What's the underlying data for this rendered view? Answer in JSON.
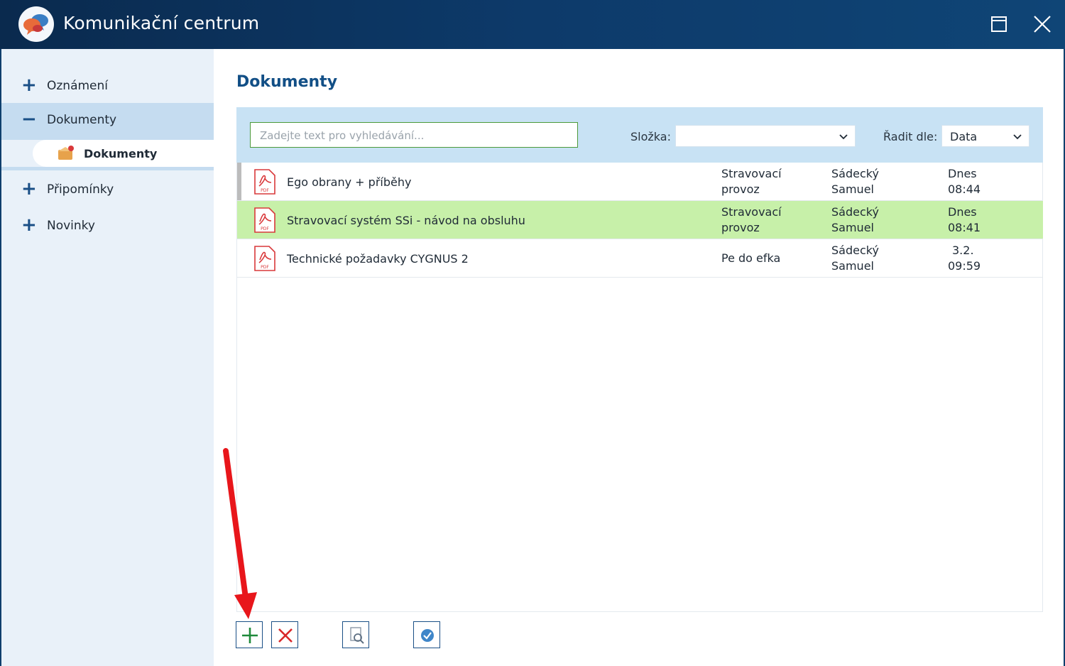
{
  "window": {
    "title": "Komunikační centrum"
  },
  "sidebar": {
    "items": [
      {
        "expander": "+",
        "label": "Oznámení"
      },
      {
        "expander": "−",
        "label": "Dokumenty"
      },
      {
        "expander": "+",
        "label": "Připomínky"
      },
      {
        "expander": "+",
        "label": "Novinky"
      }
    ],
    "sub_item": {
      "label": "Dokumenty"
    }
  },
  "main": {
    "title": "Dokumenty",
    "search": {
      "placeholder": "Zadejte text pro vyhledávání..."
    },
    "folder": {
      "label": "Složka:",
      "value": ""
    },
    "sort": {
      "label": "Řadit dle:",
      "value": "Data"
    }
  },
  "documents": [
    {
      "name": "Ego obrany + příběhy",
      "folder": [
        "Stravovací",
        "provoz"
      ],
      "author": [
        "Sádecký",
        "Samuel"
      ],
      "date": [
        "Dnes",
        "08:44"
      ],
      "selected": false
    },
    {
      "name": "Stravovací systém SSi - návod na obsluhu",
      "folder": [
        "Stravovací",
        "provoz"
      ],
      "author": [
        "Sádecký",
        "Samuel"
      ],
      "date": [
        "Dnes",
        "08:41"
      ],
      "selected": true
    },
    {
      "name": "Technické požadavky CYGNUS 2",
      "folder": [
        "Pe do efka",
        ""
      ],
      "author": [
        "Sádecký",
        "Samuel"
      ],
      "date": [
        "3.2.",
        "09:59"
      ],
      "selected": false
    }
  ],
  "file_type_badge": "PDF",
  "bottom_toolbar": {
    "icons": [
      "add-icon",
      "delete-icon",
      "preview-icon",
      "confirm-icon"
    ]
  },
  "colors": {
    "titlebar": "#0d3a6a",
    "sidebar_bg": "#e9f1f9",
    "sidebar_active": "#c5dcf0",
    "toolbar_bg": "#c8e2f4",
    "selected_row": "#c7f0a9",
    "accent": "#124f86",
    "annotation_arrow": "#e8161b"
  }
}
